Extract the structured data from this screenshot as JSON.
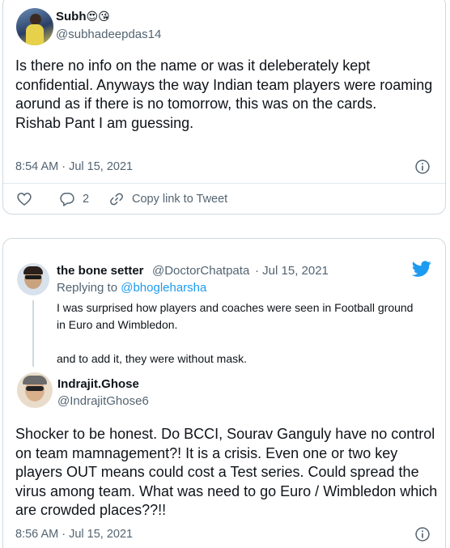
{
  "tweet1": {
    "author_name": "Subh",
    "author_emojis": "😍😘",
    "handle": "@subhadeepdas14",
    "text": "Is there no info on the name or was it deleberately kept confidential. Anyways the way Indian team players were roaming aorund as if there is no tomorrow, this was on the cards.\nRishab Pant I am guessing.",
    "timestamp": "8:54 AM · Jul 15, 2021",
    "reply_count": "2",
    "copy_link_label": "Copy link to Tweet",
    "icons": [
      "heart-icon",
      "reply-icon",
      "link-icon",
      "info-icon"
    ]
  },
  "tweet2": {
    "quoted": {
      "author_name": "the bone setter",
      "handle": "@DoctorChatpata",
      "date": "· Jul 15, 2021",
      "replying_prefix": "Replying to",
      "replying_to": "@bhogleharsha",
      "text": "I was surprised how players and coaches were seen in Football ground in Euro and Wimbledon.\n\nand to add it, they were without mask."
    },
    "author_name": "Indrajit.Ghose",
    "handle": "@IndrajitGhose6",
    "text": "Shocker to be honest. Do BCCI, Sourav Ganguly have no control on team mamnagement?! It is a crisis. Even one or two key players OUT means could cost a Test series. Could spread the virus among team. What was need to go Euro / Wimbledon which are crowded places??!!",
    "timestamp": "8:56 AM · Jul 15, 2021",
    "icons": [
      "twitter-bird-icon",
      "info-icon"
    ]
  },
  "colors": {
    "accent": "#1d9bf0",
    "text_primary": "#0f1419",
    "text_secondary": "#536471",
    "border": "#cfd9de"
  }
}
